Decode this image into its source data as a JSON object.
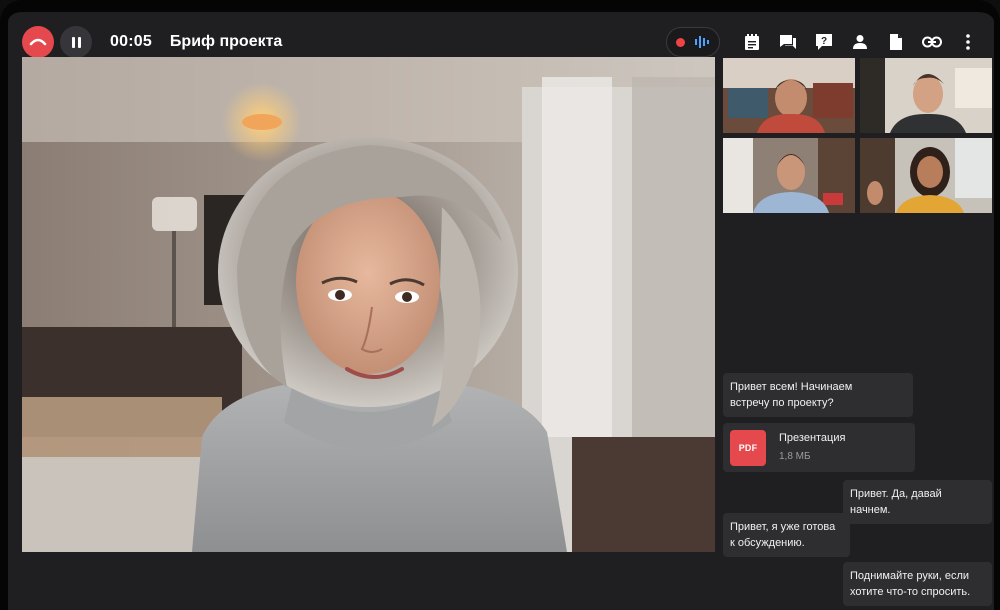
{
  "call": {
    "timer": "00:05",
    "title": "Бриф проекта"
  },
  "toolbar": {
    "icons": [
      "end-call-icon",
      "pause-icon",
      "record-icon",
      "audio-wave-icon",
      "notes-icon",
      "chat-icon",
      "help-icon",
      "person-icon",
      "document-icon",
      "link-icon",
      "more-vertical-icon"
    ]
  },
  "participants": [
    {
      "id": "main-speaker",
      "description": "woman with gray bob haircut"
    },
    {
      "id": "p1"
    },
    {
      "id": "p2"
    },
    {
      "id": "p3"
    },
    {
      "id": "p4"
    }
  ],
  "chat": {
    "messages": [
      {
        "text_line1": "Привет всем! Начинаем",
        "text_line2": "встречу по проекту?",
        "side": "left"
      },
      {
        "text_line1": "Привет. Да, давай начнем.",
        "side": "right"
      },
      {
        "text_line1": "Привет, я уже готова",
        "text_line2": "к обсуждению.",
        "side": "left"
      },
      {
        "text_line1": "Поднимайте руки, если",
        "text_line2": "хотите что-то спросить.",
        "side": "right"
      }
    ],
    "file": {
      "badge": "PDF",
      "name": "Презентация",
      "size": "1,8 МБ"
    }
  },
  "colors": {
    "accent_red": "#e5484d",
    "panel": "#1f1f21",
    "bubble": "#2e2e31",
    "record_blue": "#4aa3ff"
  }
}
